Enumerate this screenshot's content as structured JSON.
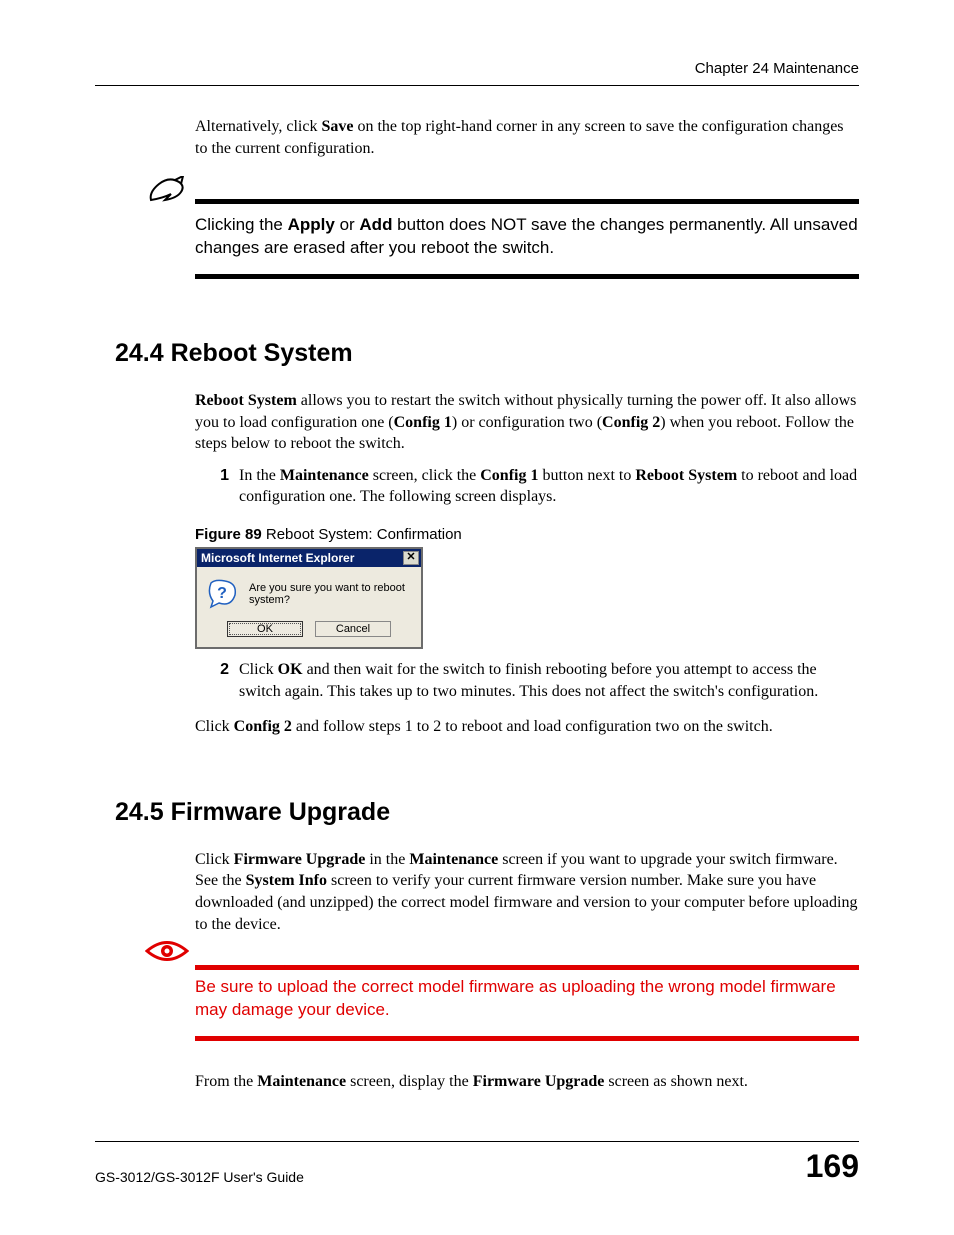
{
  "header": {
    "chapter": "Chapter 24 Maintenance"
  },
  "intro": {
    "para1_a": "Alternatively, click ",
    "para1_b": "Save",
    "para1_c": " on the top right-hand corner in any screen to save the configuration changes to the current configuration."
  },
  "note": {
    "t1": "Clicking the ",
    "t1b": "Apply",
    "t2": " or ",
    "t2b": "Add",
    "t3": " button does NOT save the changes permanently. All unsaved changes are erased after you reboot the switch."
  },
  "s244": {
    "heading": "24.4  Reboot System",
    "p1_a": "Reboot System",
    "p1_b": " allows you to restart the switch without physically turning the power off. It also allows you to load configuration one (",
    "p1_c": "Config 1",
    "p1_d": ") or configuration two (",
    "p1_e": "Config 2",
    "p1_f": ") when you reboot. Follow the steps below to reboot the switch.",
    "li1_num": "1",
    "li1_a": "In the ",
    "li1_b": "Maintenance",
    "li1_c": " screen, click the ",
    "li1_d": "Config 1",
    "li1_e": " button next to ",
    "li1_f": "Reboot System",
    "li1_g": " to reboot and load configuration one. The following screen displays.",
    "fig_label": "Figure 89",
    "fig_title": "   Reboot System: Confirmation",
    "dialog_title": "Microsoft Internet Explorer",
    "dialog_msg": "Are you sure you want to reboot system?",
    "dialog_ok": "OK",
    "dialog_cancel": "Cancel",
    "li2_num": "2",
    "li2_a": "Click ",
    "li2_b": "OK",
    "li2_c": " and then wait for the switch to finish rebooting before you attempt to access the switch again. This takes up to two minutes. This does not affect the switch's configuration.",
    "p2_a": "Click ",
    "p2_b": "Config 2",
    "p2_c": " and follow steps 1 to 2 to reboot and load configuration two on the switch."
  },
  "s245": {
    "heading": "24.5  Firmware Upgrade",
    "p1_a": "Click ",
    "p1_b": "Firmware Upgrade",
    "p1_c": " in the ",
    "p1_d": "Maintenance",
    "p1_e": " screen if you want to upgrade your switch firmware. See the ",
    "p1_f": "System Info",
    "p1_g": " screen to verify your current firmware version number. Make sure you have downloaded (and unzipped) the correct model firmware and version to your computer before uploading to the device.",
    "warn": "Be sure to upload the correct model firmware as uploading the wrong model firmware may damage your device.",
    "p2_a": "From the ",
    "p2_b": "Maintenance",
    "p2_c": " screen, display the ",
    "p2_d": "Firmware Upgrade",
    "p2_e": " screen as shown next."
  },
  "footer": {
    "guide": "GS-3012/GS-3012F User's Guide",
    "page": "169"
  }
}
